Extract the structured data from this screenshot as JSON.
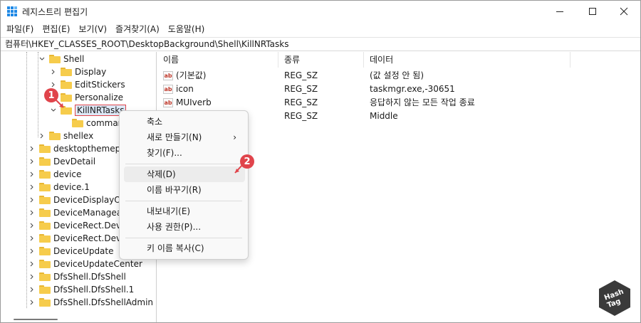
{
  "window": {
    "title": "레지스트리 편집기",
    "controls": [
      "minimize-icon",
      "maximize-icon",
      "close-icon"
    ]
  },
  "menu": [
    "파일(F)",
    "편집(E)",
    "보기(V)",
    "즐겨찾기(A)",
    "도움말(H)"
  ],
  "address": "컴퓨터\\HKEY_CLASSES_ROOT\\DesktopBackground\\Shell\\KillNRTasks",
  "tree": {
    "shell": "Shell",
    "shell_children": [
      "Display",
      "EditStickers",
      "Personalize",
      "KillNRTasks"
    ],
    "command": "command",
    "shellex": "shellex",
    "roots": [
      "desktopthemepac",
      "DevDetail",
      "device",
      "device.1",
      "DeviceDisplayOb",
      "DeviceManageab",
      "DeviceRect.Device",
      "DeviceRect.Device",
      "DeviceUpdate",
      "DeviceUpdateCenter",
      "DfsShell.DfsShell",
      "DfsShell.DfsShell.1",
      "DfsShell.DfsShellAdmin"
    ]
  },
  "list": {
    "headers": {
      "name": "이름",
      "type": "종류",
      "data": "데이터"
    },
    "rows": [
      {
        "icon": "ab",
        "name": "(기본값)",
        "type": "REG_SZ",
        "data": "(값 설정 안 됨)"
      },
      {
        "icon": "ab",
        "name": "icon",
        "type": "REG_SZ",
        "data": "taskmgr.exe,-30651"
      },
      {
        "icon": "ab",
        "name": "MUIverb",
        "type": "REG_SZ",
        "data": "응답하지 않는 모든 작업 종료"
      },
      {
        "icon": "ab",
        "name": "",
        "type": "REG_SZ",
        "data": "Middle"
      }
    ]
  },
  "context_menu": {
    "collapse": "축소",
    "new": "새로 만들기(N)",
    "find": "찾기(F)...",
    "delete": "삭제(D)",
    "rename": "이름 바꾸기(R)",
    "export": "내보내기(E)",
    "permissions": "사용 권한(P)...",
    "copy_key": "키 이름 복사(C)",
    "submenu_arrow": "›"
  },
  "badges": {
    "step1": "1",
    "step2": "2"
  },
  "logo_text": {
    "line1": "Hash",
    "line2": "Tag"
  },
  "colors": {
    "accent": "#e0444b",
    "folder": "#f6cc4c",
    "selection": "#dde8f6"
  }
}
